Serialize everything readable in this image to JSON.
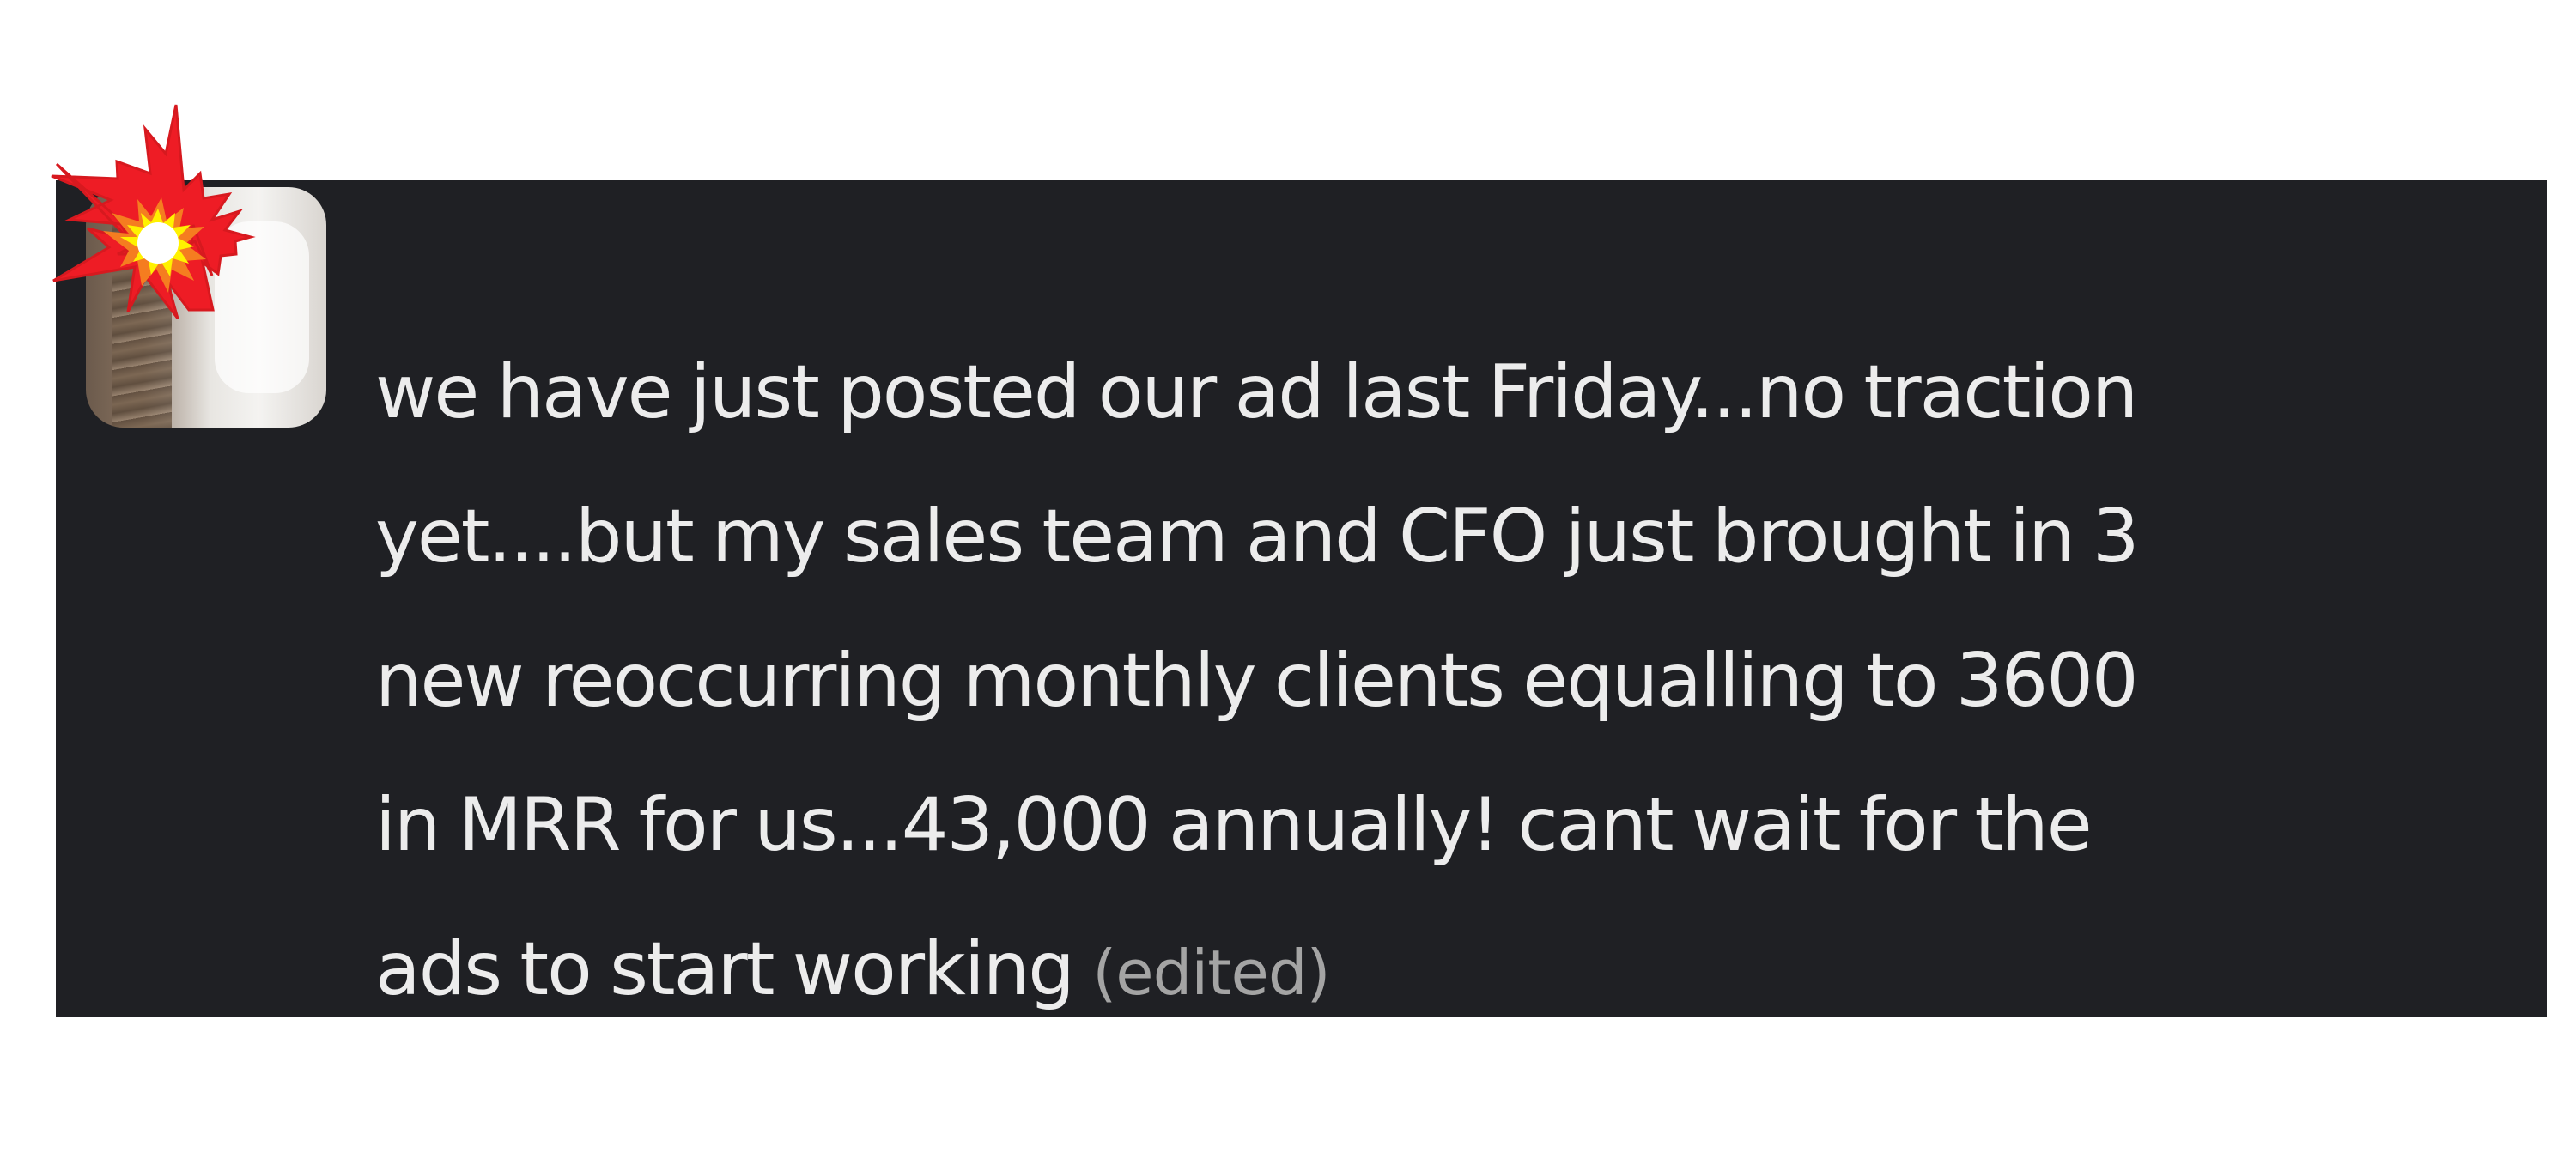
{
  "message": {
    "lines": [
      "we have just posted our ad last Friday...no traction",
      "yet....but my sales team and CFO just brought in 3",
      "new reoccurring monthly clients equalling to 3600",
      "in MRR for us...43,000 annually! cant wait for the",
      "ads to start working"
    ],
    "edited_label": "(edited)"
  },
  "avatar": {
    "overlay_icon": "collision-burst-icon"
  },
  "colors": {
    "panel_background": "#1f2024",
    "message_text": "#ececec",
    "edited_text": "#a4a4a4",
    "burst_red": "#ee1c25",
    "burst_orange": "#f57d20",
    "burst_yellow": "#fff200",
    "page_background": "#ffffff"
  }
}
